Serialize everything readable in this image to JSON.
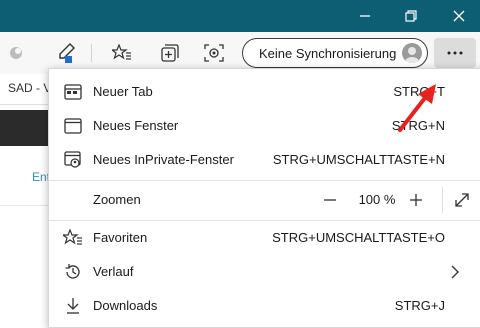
{
  "toolbar": {
    "sync_label": "Keine Synchronisierung"
  },
  "background": {
    "tab_text": "SAD - V",
    "link_text": "Ent"
  },
  "menu": {
    "items": [
      {
        "label": "Neuer Tab",
        "shortcut": "STRG+T",
        "icon": "new-tab-icon"
      },
      {
        "label": "Neues Fenster",
        "shortcut": "STRG+N",
        "icon": "new-window-icon"
      },
      {
        "label": "Neues InPrivate-Fenster",
        "shortcut": "STRG+UMSCHALTTASTE+N",
        "icon": "inprivate-window-icon"
      }
    ],
    "zoom": {
      "label": "Zoomen",
      "value": "100 %"
    },
    "items2": [
      {
        "label": "Favoriten",
        "shortcut": "STRG+UMSCHALTTASTE+O",
        "icon": "favorites-icon"
      },
      {
        "label": "Verlauf",
        "icon": "history-icon"
      },
      {
        "label": "Downloads",
        "shortcut": "STRG+J",
        "icon": "downloads-icon"
      }
    ]
  },
  "colors": {
    "titlebar": "#0e5e73",
    "annotation_arrow": "#e8211e"
  }
}
